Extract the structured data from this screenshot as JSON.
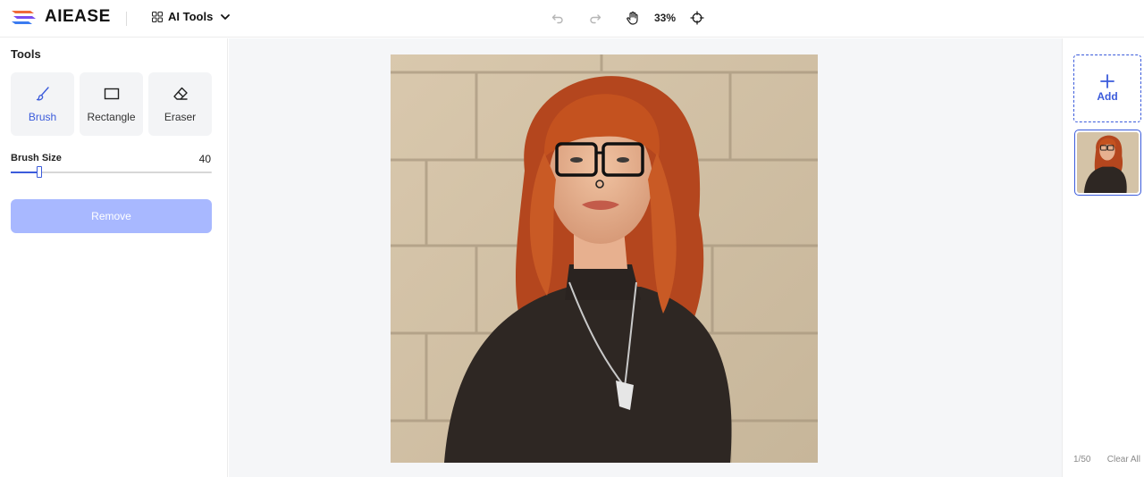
{
  "header": {
    "logo_text": "AIEASE",
    "ai_tools_label": "AI Tools",
    "zoom_label": "33%"
  },
  "left_panel": {
    "title": "Tools",
    "tools": [
      {
        "label": "Brush",
        "icon": "brush-icon",
        "active": true
      },
      {
        "label": "Rectangle",
        "icon": "rectangle-icon",
        "active": false
      },
      {
        "label": "Eraser",
        "icon": "eraser-icon",
        "active": false
      }
    ],
    "brush_size_label": "Brush Size",
    "brush_size_value": "40",
    "brush_size_fraction": 0.14,
    "remove_label": "Remove"
  },
  "right_panel": {
    "add_label": "Add",
    "count": "1/50",
    "clear_all_label": "Clear All"
  },
  "colors": {
    "accent": "#3b5bdb",
    "remove_button": "#a8b8ff",
    "canvas_bg": "#f5f6f8"
  }
}
